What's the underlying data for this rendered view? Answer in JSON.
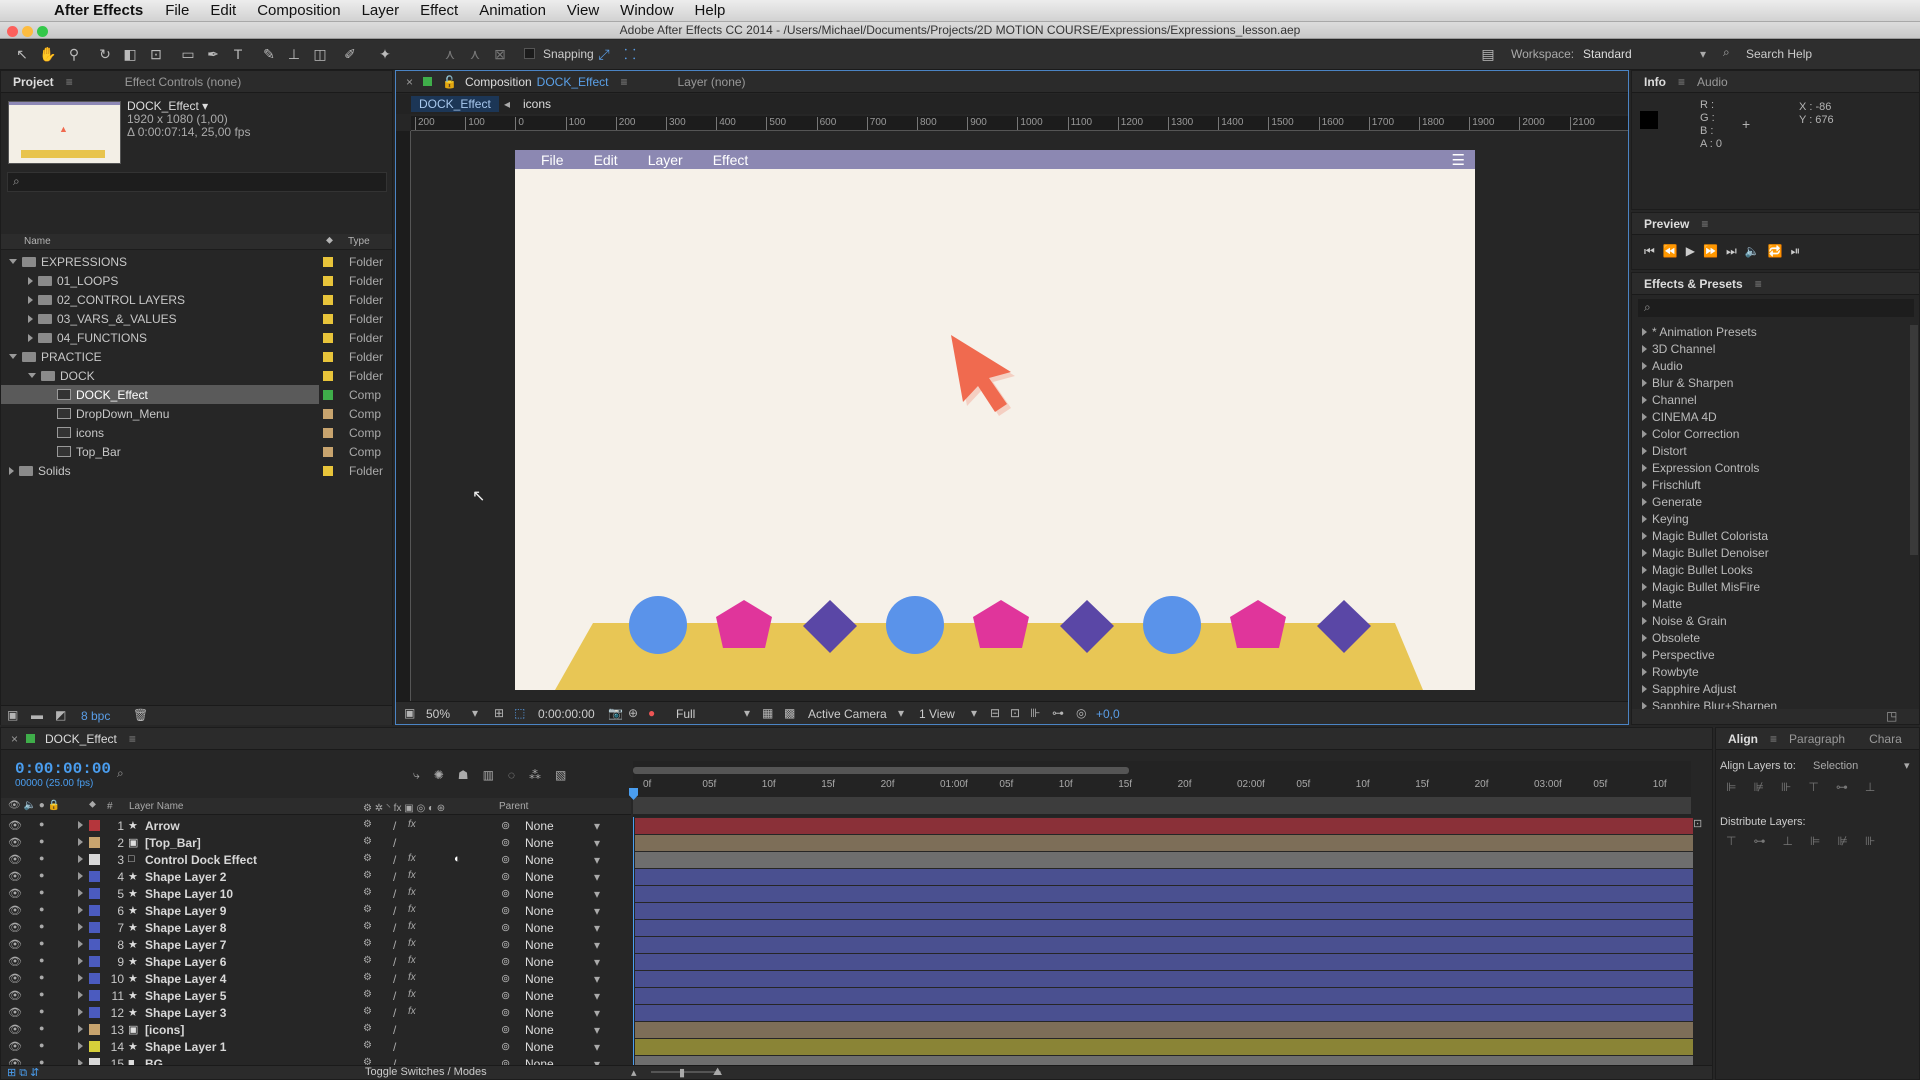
{
  "menubar": {
    "app": "After Effects",
    "items": [
      "File",
      "Edit",
      "Composition",
      "Layer",
      "Effect",
      "Animation",
      "View",
      "Window",
      "Help"
    ]
  },
  "titlebar": {
    "title": "Adobe After Effects CC 2014 - /Users/Michael/Documents/Projects/2D MOTION COURSE/Expressions/Expressions_lesson.aep"
  },
  "toolbar": {
    "snapping": "Snapping",
    "workspace_label": "Workspace:",
    "workspace_value": "Standard",
    "search_help": "Search Help"
  },
  "project": {
    "tab": "Project",
    "effect_controls": "Effect Controls (none)",
    "selected_name": "DOCK_Effect ▾",
    "selected_size": "1920 x 1080 (1,00)",
    "selected_duration": "Δ 0:00:07:14, 25,00 fps",
    "col_name": "Name",
    "col_type": "Type",
    "bpc": "8 bpc",
    "items": [
      {
        "name": "EXPRESSIONS",
        "type": "Folder",
        "level": 0,
        "kind": "folder",
        "open": true,
        "color": "#e8c43a"
      },
      {
        "name": "01_LOOPS",
        "type": "Folder",
        "level": 1,
        "kind": "folder",
        "open": false,
        "color": "#e8c43a"
      },
      {
        "name": "02_CONTROL LAYERS",
        "type": "Folder",
        "level": 1,
        "kind": "folder",
        "open": false,
        "color": "#e8c43a"
      },
      {
        "name": "03_VARS_&_VALUES",
        "type": "Folder",
        "level": 1,
        "kind": "folder",
        "open": false,
        "color": "#e8c43a"
      },
      {
        "name": "04_FUNCTIONS",
        "type": "Folder",
        "level": 1,
        "kind": "folder",
        "open": false,
        "color": "#e8c43a"
      },
      {
        "name": "PRACTICE",
        "type": "Folder",
        "level": 0,
        "kind": "folder",
        "open": true,
        "color": "#e8c43a"
      },
      {
        "name": "DOCK",
        "type": "Folder",
        "level": 1,
        "kind": "folder",
        "open": true,
        "color": "#e8c43a"
      },
      {
        "name": "DOCK_Effect",
        "type": "Comp",
        "level": 2,
        "kind": "comp",
        "color": "#3fae4a",
        "selected": true
      },
      {
        "name": "DropDown_Menu",
        "type": "Comp",
        "level": 2,
        "kind": "comp",
        "color": "#c8a46e"
      },
      {
        "name": "icons",
        "type": "Comp",
        "level": 2,
        "kind": "comp",
        "color": "#c8a46e"
      },
      {
        "name": "Top_Bar",
        "type": "Comp",
        "level": 2,
        "kind": "comp",
        "color": "#c8a46e"
      },
      {
        "name": "Solids",
        "type": "Folder",
        "level": 0,
        "kind": "folder",
        "open": false,
        "color": "#e8c43a"
      }
    ]
  },
  "composition": {
    "tab_prefix": "Composition",
    "tab_name": "DOCK_Effect",
    "layer_tab": "Layer (none)",
    "crumb1": "DOCK_Effect",
    "crumb2": "icons",
    "ruler": [
      "200",
      "100",
      "0",
      "100",
      "200",
      "300",
      "400",
      "500",
      "600",
      "700",
      "800",
      "900",
      "1000",
      "1100",
      "1200",
      "1300",
      "1400",
      "1500",
      "1600",
      "1700",
      "1800",
      "1900",
      "2000",
      "2100"
    ],
    "inner_menu": [
      "File",
      "Edit",
      "Layer",
      "Effect"
    ],
    "zoom": "50%",
    "timecode": "0:00:00:00",
    "resolution": "Full",
    "camera": "Active Camera",
    "views": "1 View",
    "exposure": "+0,0"
  },
  "info": {
    "tab": "Info",
    "audio": "Audio",
    "r": "R :",
    "g": "G :",
    "b": "B :",
    "a": "A : 0",
    "x": "X : -86",
    "y": "Y : 676"
  },
  "preview": {
    "tab": "Preview"
  },
  "effects": {
    "tab": "Effects & Presets",
    "items": [
      "* Animation Presets",
      "3D Channel",
      "Audio",
      "Blur & Sharpen",
      "Channel",
      "CINEMA 4D",
      "Color Correction",
      "Distort",
      "Expression Controls",
      "Frischluft",
      "Generate",
      "Keying",
      "Magic Bullet Colorista",
      "Magic Bullet Denoiser",
      "Magic Bullet Looks",
      "Magic Bullet MisFire",
      "Matte",
      "Noise & Grain",
      "Obsolete",
      "Perspective",
      "Rowbyte",
      "Sapphire Adjust",
      "Sapphire Blur+Sharpen"
    ]
  },
  "timeline": {
    "tab": "DOCK_Effect",
    "timecode": "0:00:00:00",
    "frames": "00000 (25.00 fps)",
    "col_layer": "Layer Name",
    "col_parent": "Parent",
    "col_hash": "#",
    "ticks": [
      "0f",
      "05f",
      "10f",
      "15f",
      "20f",
      "01:00f",
      "05f",
      "10f",
      "15f",
      "20f",
      "02:00f",
      "05f",
      "10f",
      "15f",
      "20f",
      "03:00f",
      "05f",
      "10f"
    ],
    "toggle": "Toggle Switches / Modes",
    "layers": [
      {
        "n": "1",
        "name": "Arrow",
        "icon": "star",
        "color": "#b5363c",
        "bar": "#8a3038",
        "fx": true
      },
      {
        "n": "2",
        "name": "[Top_Bar]",
        "icon": "comp",
        "color": "#c8a46e",
        "bar": "#7d6e58",
        "fx": false
      },
      {
        "n": "3",
        "name": "Control Dock Effect",
        "icon": "null",
        "color": "#d8d8d8",
        "bar": "#6e6e6e",
        "fx": true
      },
      {
        "n": "4",
        "name": "Shape Layer 2",
        "icon": "star",
        "color": "#4b5bbf",
        "bar": "#4a5090",
        "fx": true
      },
      {
        "n": "5",
        "name": "Shape Layer 10",
        "icon": "star",
        "color": "#4b5bbf",
        "bar": "#4a5090",
        "fx": true
      },
      {
        "n": "6",
        "name": "Shape Layer 9",
        "icon": "star",
        "color": "#4b5bbf",
        "bar": "#4a5090",
        "fx": true
      },
      {
        "n": "7",
        "name": "Shape Layer 8",
        "icon": "star",
        "color": "#4b5bbf",
        "bar": "#4a5090",
        "fx": true
      },
      {
        "n": "8",
        "name": "Shape Layer 7",
        "icon": "star",
        "color": "#4b5bbf",
        "bar": "#4a5090",
        "fx": true
      },
      {
        "n": "9",
        "name": "Shape Layer 6",
        "icon": "star",
        "color": "#4b5bbf",
        "bar": "#4a5090",
        "fx": true
      },
      {
        "n": "10",
        "name": "Shape Layer 4",
        "icon": "star",
        "color": "#4b5bbf",
        "bar": "#4a5090",
        "fx": true
      },
      {
        "n": "11",
        "name": "Shape Layer 5",
        "icon": "star",
        "color": "#4b5bbf",
        "bar": "#4a5090",
        "fx": true
      },
      {
        "n": "12",
        "name": "Shape Layer 3",
        "icon": "star",
        "color": "#4b5bbf",
        "bar": "#4a5090",
        "fx": true
      },
      {
        "n": "13",
        "name": "[icons]",
        "icon": "comp",
        "color": "#c8a46e",
        "bar": "#7d6e58",
        "fx": false
      },
      {
        "n": "14",
        "name": "Shape Layer 1",
        "icon": "star",
        "color": "#d6cf3a",
        "bar": "#8a8436",
        "fx": false
      },
      {
        "n": "15",
        "name": "BG",
        "icon": "solid",
        "color": "#d8d8d8",
        "bar": "#6e6e6e",
        "fx": false
      }
    ],
    "parent_value": "None"
  },
  "align": {
    "tab": "Align",
    "paragraph": "Paragraph",
    "character": "Chara",
    "align_to": "Align Layers to:",
    "align_value": "Selection",
    "distribute": "Distribute Layers:"
  }
}
